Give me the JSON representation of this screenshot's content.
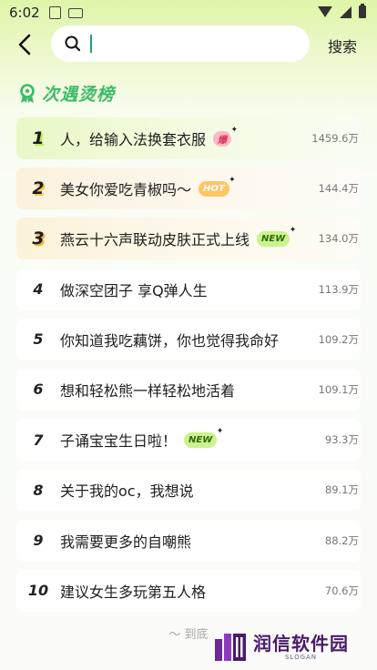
{
  "status_bar": {
    "time": "6:02"
  },
  "header": {
    "search_placeholder": "",
    "search_button": "搜索"
  },
  "board": {
    "title": "次遇烫榜",
    "items": [
      {
        "rank": "1",
        "text": "人，给输入法换套衣服",
        "badge": "爆",
        "badge_type": "bao",
        "hot": "1459.6万"
      },
      {
        "rank": "2",
        "text": "美女你爱吃青椒吗～",
        "badge": "HOT",
        "badge_type": "hot",
        "hot": "144.4万"
      },
      {
        "rank": "3",
        "text": "燕云十六声联动皮肤正式上线",
        "badge": "NEW",
        "badge_type": "new",
        "hot": "134.0万"
      },
      {
        "rank": "4",
        "text": "做深空团子 享Q弹人生",
        "badge": "",
        "badge_type": "",
        "hot": "113.9万"
      },
      {
        "rank": "5",
        "text": "你知道我吃藕饼，你也觉得我命好",
        "badge": "",
        "badge_type": "",
        "hot": "109.2万"
      },
      {
        "rank": "6",
        "text": "想和轻松熊一样轻松地活着",
        "badge": "",
        "badge_type": "",
        "hot": "109.1万"
      },
      {
        "rank": "7",
        "text": "子诵宝宝生日啦！",
        "badge": "NEW",
        "badge_type": "new",
        "hot": "93.3万"
      },
      {
        "rank": "8",
        "text": "关于我的oc，我想说",
        "badge": "",
        "badge_type": "",
        "hot": "89.1万"
      },
      {
        "rank": "9",
        "text": "我需要更多的自嘲熊",
        "badge": "",
        "badge_type": "",
        "hot": "88.2万"
      },
      {
        "rank": "10",
        "text": "建议女生多玩第五人格",
        "badge": "",
        "badge_type": "",
        "hot": "70.6万"
      }
    ]
  },
  "footer": {
    "end_text": "～ 到底"
  },
  "watermark": {
    "title": "润信软件园",
    "slogan": "SLOGAN"
  },
  "colors": {
    "accent": "#3dbb68",
    "bg_top": "#dff5a8"
  }
}
